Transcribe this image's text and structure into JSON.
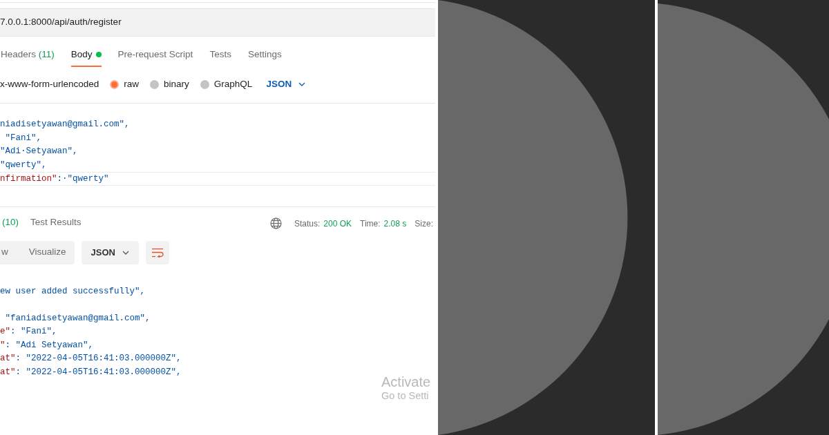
{
  "request": {
    "url": "7.0.0.1:8000/api/auth/register",
    "tabs": [
      {
        "label": "Headers",
        "count": "(11)",
        "dot": false,
        "selected": false
      },
      {
        "label": "Body",
        "dot": true,
        "selected": true
      },
      {
        "label": "Pre-request Script",
        "dot": false,
        "selected": false
      },
      {
        "label": "Tests",
        "dot": false,
        "selected": false
      },
      {
        "label": "Settings",
        "dot": false,
        "selected": false
      }
    ],
    "body_types": [
      {
        "kind": "text",
        "label": "x-www-form-urlencoded"
      },
      {
        "kind": "radio",
        "label": "raw",
        "selected": true
      },
      {
        "kind": "radio",
        "label": "binary",
        "selected": false
      },
      {
        "kind": "radio",
        "label": "GraphQL",
        "selected": false
      }
    ],
    "format": "JSON",
    "code_lines": [
      {
        "value": "niadisetyawan@gmail.com\","
      },
      {
        "value": " \"Fani\","
      },
      {
        "value": "\"Adi·Setyawan\","
      },
      {
        "value": "\"qwerty\","
      },
      {
        "key": "nfirmation\"",
        "value": ":·\"qwerty\"",
        "current": true
      }
    ]
  },
  "response": {
    "tabs": [
      {
        "count": "(10)"
      },
      {
        "label": "Test Results"
      }
    ],
    "status": [
      {
        "label": "Status:",
        "value": "200 OK"
      },
      {
        "label": "Time:",
        "value": "2.08 s"
      },
      {
        "label": "Size:"
      }
    ],
    "view_tabs": [
      "w",
      "Visualize"
    ],
    "format": "JSON",
    "code_groups": [
      [
        {
          "value": "ew user added successfully\","
        }
      ],
      [
        {
          "value": " \"faniadisetyawan@gmail.com\","
        },
        {
          "key": "e\"",
          "value": ": \"Fani\","
        },
        {
          "key": "\"",
          "value": ": \"Adi Setyawan\","
        },
        {
          "key": "at\"",
          "value": ": \"2022-04-05T16:41:03.000000Z\","
        },
        {
          "key": "at\"",
          "value": ": \"2022-04-05T16:41:03.000000Z\","
        }
      ]
    ]
  },
  "os_notice": {
    "title": "Activate",
    "subtitle": "Go to Setti"
  }
}
